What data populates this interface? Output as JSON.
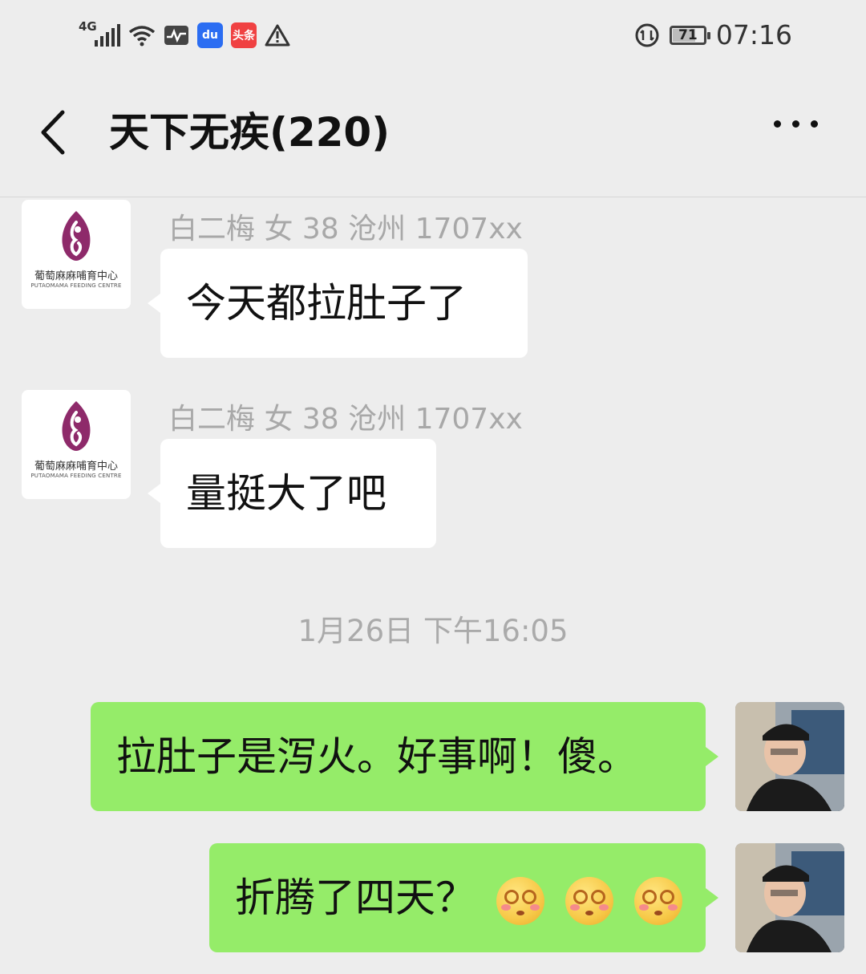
{
  "status_bar": {
    "network": "4G",
    "app_badge_toutiao": "头条",
    "app_badge_baidu": "du",
    "battery": 71,
    "battery_text": "71",
    "time": "07:16"
  },
  "header": {
    "title": "天下无疾(220)"
  },
  "logo": {
    "cn": "葡萄麻麻哺育中心",
    "en": "PUTAOMAMA FEEDING CENTRE"
  },
  "messages": [
    {
      "sender": "白二梅 女 38 沧州 1707xx",
      "text": "今天都拉肚子了"
    },
    {
      "sender": "白二梅 女 38 沧州 1707xx",
      "text": "量挺大了吧"
    },
    {
      "text": "拉肚子是泻火。好事啊！傻。"
    },
    {
      "text": "折腾了四天？"
    }
  ],
  "timestamp": "1月26日 下午16:05",
  "colors": {
    "background": "#ededed",
    "outgoing_bubble": "#95ec69",
    "incoming_bubble": "#ffffff",
    "logo_purple": "#8e2a6a"
  },
  "icons": [
    "back-icon",
    "more-icon",
    "dizzy-face-emoji"
  ]
}
